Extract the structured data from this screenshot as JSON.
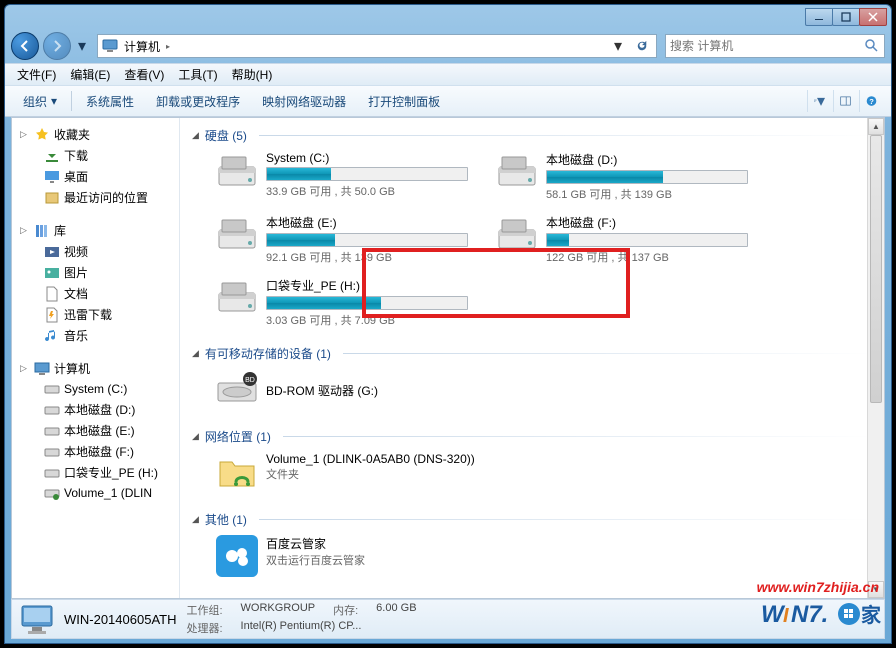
{
  "titlebar": {
    "min": "—",
    "max": "□",
    "close": "✕"
  },
  "nav": {
    "back": "←",
    "fwd": "→"
  },
  "breadcrumb": {
    "root": "计算机",
    "sep": "▸"
  },
  "search": {
    "placeholder": "搜索 计算机"
  },
  "menu": {
    "file": "文件(F)",
    "edit": "编辑(E)",
    "view": "查看(V)",
    "tools": "工具(T)",
    "help": "帮助(H)"
  },
  "toolbar": {
    "organize": "组织",
    "props": "系统属性",
    "uninstall": "卸载或更改程序",
    "netdrive": "映射网络驱动器",
    "cpanel": "打开控制面板"
  },
  "sidebar": {
    "fav": "收藏夹",
    "fav_items": [
      "下载",
      "桌面",
      "最近访问的位置"
    ],
    "lib": "库",
    "lib_items": [
      "视频",
      "图片",
      "文档",
      "迅雷下载",
      "音乐"
    ],
    "comp": "计算机",
    "comp_items": [
      "System (C:)",
      "本地磁盘 (D:)",
      "本地磁盘 (E:)",
      "本地磁盘 (F:)",
      "口袋专业_PE (H:)",
      "Volume_1 (DLIN"
    ]
  },
  "sections": {
    "hdd": "硬盘 (5)",
    "removable": "有可移动存储的设备 (1)",
    "network": "网络位置 (1)",
    "other": "其他 (1)"
  },
  "drives": [
    {
      "name": "System (C:)",
      "text": "33.9 GB 可用 , 共 50.0 GB",
      "pct": 32
    },
    {
      "name": "本地磁盘 (D:)",
      "text": "58.1 GB 可用 , 共 139 GB",
      "pct": 58
    },
    {
      "name": "本地磁盘 (E:)",
      "text": "92.1 GB 可用 , 共 139 GB",
      "pct": 34
    },
    {
      "name": "本地磁盘 (F:)",
      "text": "122 GB 可用 , 共 137 GB",
      "pct": 11
    },
    {
      "name": "口袋专业_PE (H:)",
      "text": "3.03 GB 可用 , 共 7.09 GB",
      "pct": 57
    }
  ],
  "removable": {
    "name": "BD-ROM 驱动器 (G:)"
  },
  "network": {
    "name": "Volume_1 (DLINK-0A5AB0 (DNS-320))",
    "sub": "文件夹"
  },
  "other": {
    "name": "百度云管家",
    "sub": "双击运行百度云管家"
  },
  "status": {
    "name": "WIN-20140605ATH",
    "wg_label": "工作组:",
    "wg": "WORKGROUP",
    "mem_label": "内存:",
    "mem": "6.00 GB",
    "cpu_label": "处理器:",
    "cpu": "Intel(R) Pentium(R) CP..."
  },
  "watermark": "www.win7zhijia.cn",
  "logo": "WIN7.家"
}
